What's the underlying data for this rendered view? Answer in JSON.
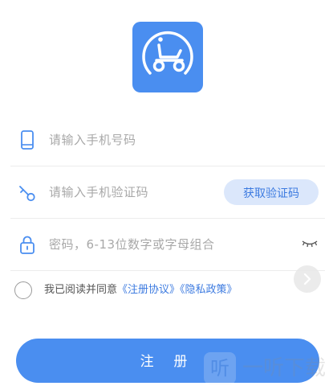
{
  "app": {
    "brand_color": "#4a8ef0",
    "logo_icon": "scooter-icon"
  },
  "phone_field": {
    "icon": "phone-icon",
    "placeholder": "请输入手机号码"
  },
  "code_field": {
    "icon": "key-icon",
    "placeholder": "请输入手机验证码",
    "button_label": "获取验证码"
  },
  "password_field": {
    "icon": "lock-icon",
    "placeholder": "密码，6-13位数字或字母组合",
    "toggle_icon": "eye-closed-icon"
  },
  "agreement": {
    "prefix": "我已阅读并同意",
    "terms_link": "《注册协议》",
    "privacy_link": "《隐私政策》",
    "checked": false
  },
  "register_button": {
    "label": "注 册"
  },
  "watermark": {
    "box_glyph": "听",
    "text": "一听下载"
  }
}
